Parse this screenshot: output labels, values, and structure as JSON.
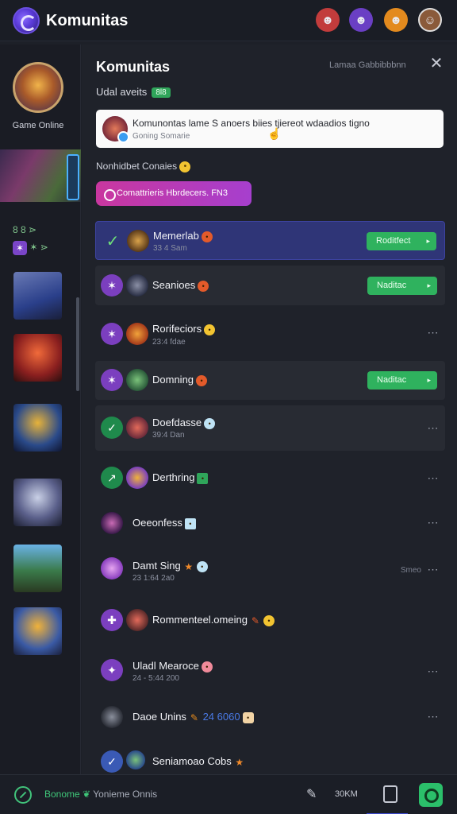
{
  "app": {
    "title": "Komunitas"
  },
  "header": {
    "avatars": [
      {
        "name": "profile-avatar-red",
        "color": "#c23c3c"
      },
      {
        "name": "profile-avatar-purple",
        "color": "#6a3fc4"
      },
      {
        "name": "profile-avatar-orange",
        "color": "#e38a1e"
      },
      {
        "name": "profile-avatar-user",
        "color": "#8a5a3a"
      }
    ]
  },
  "sidebar": {
    "label": "Game Online",
    "chips_line1": "8 8 ⋗",
    "chips_line2": "✶ ⋗"
  },
  "panel": {
    "title": "Komunitas",
    "subtitle": "Lamaa Gabbibbbnn",
    "section_label": "Udal aveits",
    "section_tag": "8l8",
    "notice_text": "Komunontas lame S anoers biies tjiereot wdaadios tigno",
    "notice_sub": "Goning Somarie",
    "featured_label": "Nonhidbet Conaies",
    "featured_emoji": "😮",
    "pink_button": "Comattrieris Hbrdecers. FN3"
  },
  "rows": [
    {
      "name": "Memerlab",
      "meta": "33 4 Sam",
      "button": "Roditfect",
      "badge": "●"
    },
    {
      "name": "Seanioes",
      "meta": "",
      "button": "Naditac",
      "badge": "●"
    },
    {
      "name": "Rorifeciors",
      "meta": "23:4 fdae",
      "badge": "●"
    },
    {
      "name": "Domning",
      "meta": "",
      "button": "Naditac",
      "badge": "●"
    },
    {
      "name": "Doefdasse",
      "meta": "39:4 Dan",
      "badge": "●"
    },
    {
      "name": "Derthring",
      "meta": "",
      "badge": "●"
    },
    {
      "name": "Oeeonfess",
      "meta": "",
      "badge": "●"
    },
    {
      "name": "Damt Sing",
      "meta": "23 1:64 2a0",
      "badge": "●",
      "extra": "Smeo"
    },
    {
      "name": "Rommenteel.omeing",
      "meta": "",
      "badge": "●"
    },
    {
      "name": "Uladl Mearoce",
      "meta": "24 - 5:44 200",
      "badge": "●"
    },
    {
      "name": "Daoe Unins",
      "meta": "",
      "extra_inline": "24 6060",
      "badge": "●"
    },
    {
      "name": "Seniamoao Cobs",
      "meta": "",
      "badge": "●"
    }
  ],
  "bottombar": {
    "status_green": "Bonome",
    "status_text": "Yonieme Onnis",
    "count": "30KM"
  },
  "colors": {
    "accent_green": "#2fb25e",
    "accent_purple": "#7b3fbf",
    "active_row": "#2f3577",
    "pink_gradient_start": "#c9379f"
  }
}
